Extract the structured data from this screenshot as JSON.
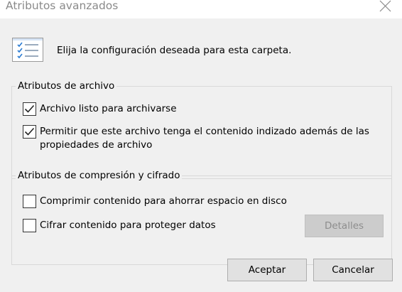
{
  "window": {
    "title": "Atributos avanzados"
  },
  "intro": {
    "text": "Elija la configuración deseada para esta carpeta."
  },
  "archive_group": {
    "legend": "Atributos de archivo",
    "options": [
      {
        "label": "Archivo listo para archivarse",
        "checked": true
      },
      {
        "label": "Permitir que este archivo tenga el contenido indizado además de las propiedades de archivo",
        "checked": true
      }
    ]
  },
  "compress_group": {
    "legend": "Atributos de compresión y cifrado",
    "options": [
      {
        "label": "Comprimir contenido para ahorrar espacio en disco",
        "checked": false
      },
      {
        "label": "Cifrar contenido para proteger datos",
        "checked": false
      }
    ],
    "details_label": "Detalles",
    "details_enabled": false
  },
  "buttons": {
    "ok_label": "Aceptar",
    "cancel_label": "Cancelar"
  },
  "colors": {
    "dialog_background": "#f0f0f0",
    "icon_accent": "#2b7cd3",
    "disabled_text": "#8d8d8d"
  },
  "icons": {
    "header": "checklist-icon",
    "close": "close-icon",
    "check": "checkmark-icon"
  }
}
